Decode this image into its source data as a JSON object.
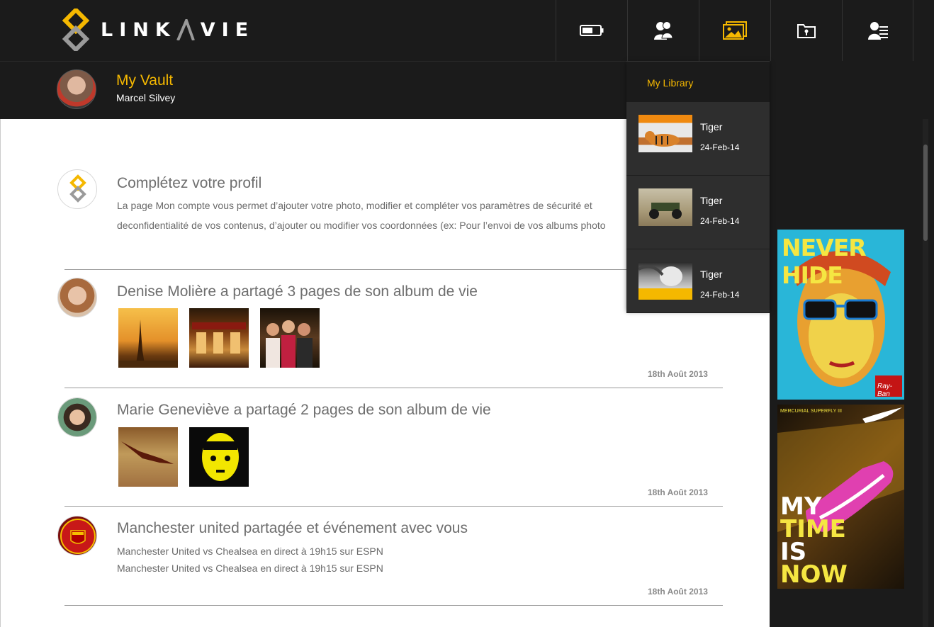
{
  "brand": {
    "name_left": "LINK",
    "name_right": "VIE"
  },
  "nav": {
    "icons": [
      "battery-icon",
      "friends-icon",
      "gallery-icon",
      "vault-icon",
      "contacts-icon"
    ]
  },
  "header": {
    "title": "My Vault",
    "user": "Marcel Silvey"
  },
  "feed": [
    {
      "title": "Complétez votre profil",
      "lines": [
        "La page Mon compte  vous permet d’ajouter votre photo, modifier et compléter vos paramètres de sécurité et",
        "deconfidentialité de vos contenus, d’ajouter ou modifier vos coordonnées (ex: Pour l’envoi de vos albums photo"
      ]
    },
    {
      "title": "Denise Molière a partagé 3 pages de son album de vie",
      "date": "18th Août 2013"
    },
    {
      "title": "Marie Geneviève a partagé 2 pages de son album de vie",
      "date": "18th Août 2013"
    },
    {
      "title": "Manchester united partagée et événement avec vous",
      "lines": [
        "Manchester United vs Chealsea en direct à 19h15 sur ESPN",
        "Manchester United vs Chealsea en direct à 19h15 sur ESPN"
      ],
      "date": "18th Août 2013"
    }
  ],
  "library": {
    "title": "My Library",
    "items": [
      {
        "name": "Tiger",
        "date": "24-Feb-14"
      },
      {
        "name": "Tiger",
        "date": "24-Feb-14"
      },
      {
        "name": "Tiger",
        "date": "24-Feb-14"
      }
    ]
  },
  "ads": {
    "rayban": {
      "headline": "NEVER HIDE",
      "brand": "Ray-Ban"
    },
    "nike": {
      "tagline": "MERCURIAL SUPERFLY III",
      "line1": "MY",
      "line2": "TIME",
      "line3": "IS",
      "line4": "NOW"
    }
  },
  "colors": {
    "accent": "#f5b800",
    "dark": "#1b1b1b",
    "panel": "#2e2e2e"
  }
}
